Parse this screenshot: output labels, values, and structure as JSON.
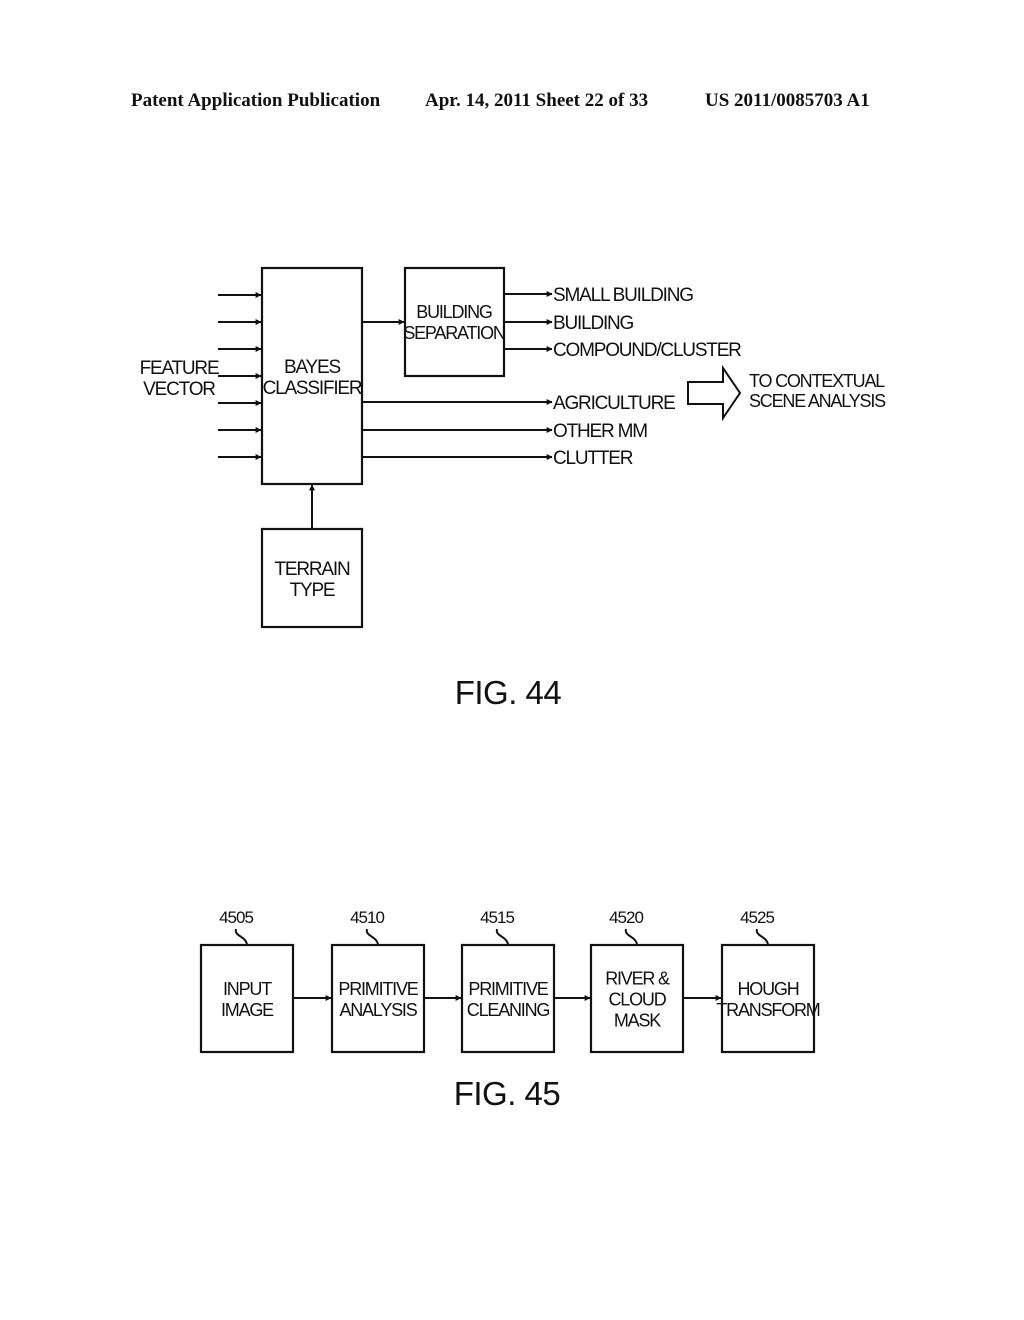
{
  "header": {
    "publication": "Patent Application Publication",
    "date_sheet": "Apr. 14, 2011  Sheet 22 of 33",
    "number": "US 2011/0085703 A1"
  },
  "fig44": {
    "caption": "FIG. 44",
    "input_label": [
      "FEATURE",
      "VECTOR"
    ],
    "input_arrow_count": 7,
    "bayes": [
      "BAYES",
      "CLASSIFIER"
    ],
    "building_sep": [
      "BUILDING",
      "SEPARATION"
    ],
    "terrain": [
      "TERRAIN",
      "TYPE"
    ],
    "building_outputs": [
      "SMALL BUILDING",
      "BUILDING",
      "COMPOUND/CLUSTER"
    ],
    "direct_outputs": [
      "AGRICULTURE",
      "OTHER MM",
      "CLUTTER"
    ],
    "destination": [
      "TO CONTEXTUAL",
      "SCENE ANALYSIS"
    ]
  },
  "fig45": {
    "caption": "FIG. 45",
    "blocks": [
      {
        "ref": "4505",
        "lines": [
          "INPUT",
          "IMAGE"
        ]
      },
      {
        "ref": "4510",
        "lines": [
          "PRIMITIVE",
          "ANALYSIS"
        ]
      },
      {
        "ref": "4515",
        "lines": [
          "PRIMITIVE",
          "CLEANING"
        ]
      },
      {
        "ref": "4520",
        "lines": [
          "RIVER &",
          "CLOUD",
          "MASK"
        ]
      },
      {
        "ref": "4525",
        "lines": [
          "HOUGH",
          "TRANSFORM"
        ]
      }
    ]
  }
}
